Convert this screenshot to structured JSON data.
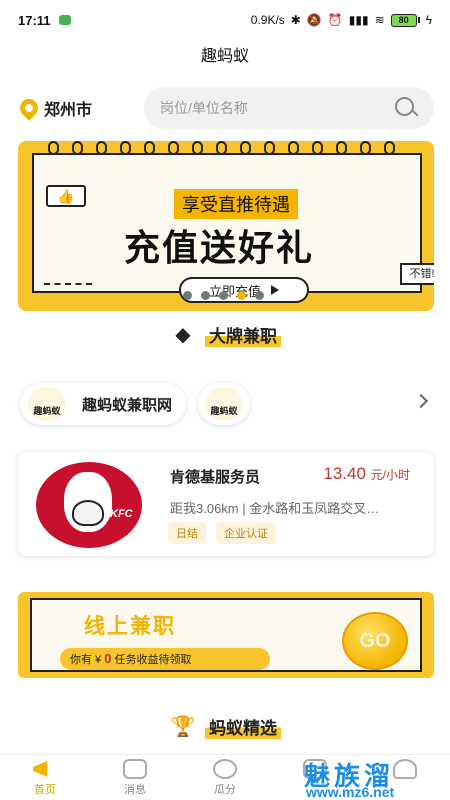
{
  "status_bar": {
    "time": "17:11",
    "net_speed": "0.9K/s",
    "battery": "80"
  },
  "app_title": "趣蚂蚁",
  "location": {
    "city": "郑州市"
  },
  "search": {
    "placeholder": "岗位/单位名称"
  },
  "banner": {
    "subtitle": "享受直推待遇",
    "headline": "充值送好礼",
    "cta": "立即充值",
    "bubble": "不错!",
    "page_count": 5,
    "active_page": 4
  },
  "section_brand": {
    "title": "大牌兼职",
    "icon": "diamond-icon"
  },
  "tags": [
    {
      "logo": "趣蚂蚁",
      "label": "趣蚂蚁兼职网"
    },
    {
      "logo": "趣蚂蚁",
      "label": ""
    }
  ],
  "job": {
    "title": "肯德基服务员",
    "salary": "13.40",
    "unit": "元/小时",
    "meta": "距我3.06km | 金水路和玉凤路交叉…",
    "chips": [
      "日结",
      "企业认证"
    ],
    "logo_text": "KFC"
  },
  "online": {
    "title": "线上兼职",
    "note_prefix": "你有 ¥",
    "amount": "0",
    "note_suffix": "任务收益待领取",
    "go": "GO"
  },
  "section_select": {
    "title": "蚂蚁精选",
    "icon": "trophy-icon"
  },
  "tabbar": [
    {
      "label": "首页",
      "active": true,
      "icon": "home-icon"
    },
    {
      "label": "消息",
      "active": false,
      "icon": "message-icon"
    },
    {
      "label": "瓜分",
      "active": false,
      "icon": "melon-icon"
    },
    {
      "label": "",
      "active": false,
      "icon": "task-icon"
    },
    {
      "label": "",
      "active": false,
      "icon": "user-icon"
    }
  ],
  "watermark": {
    "text": "魅族溜",
    "url": "www.mz6.net"
  },
  "colors": {
    "accent": "#f7c52b",
    "salary": "#c0392b",
    "watermark": "#1d8ee8"
  }
}
